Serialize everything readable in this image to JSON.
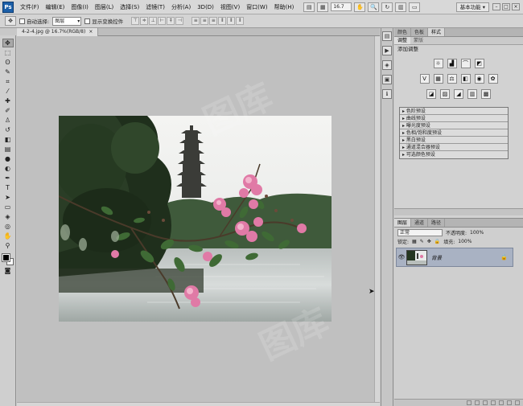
{
  "app": {
    "logo": "Ps"
  },
  "menu": [
    "文件(F)",
    "编辑(E)",
    "图像(I)",
    "图层(L)",
    "选择(S)",
    "滤镜(T)",
    "分析(A)",
    "3D(D)",
    "视图(V)",
    "窗口(W)",
    "帮助(H)"
  ],
  "menu_tools": {
    "zoom": "16.7",
    "workspace": "基本功能 ▾"
  },
  "options": {
    "auto_select_label": "自动选择:",
    "auto_select_value": "图层",
    "show_transform_label": "显示变换控件"
  },
  "document": {
    "tab_title": "4-2-4.jpg @ 16.7%(RGB/8)",
    "tab_close": "×"
  },
  "panel_top": {
    "tabs": [
      "颜色",
      "色板",
      "样式"
    ],
    "sub_tabs": [
      "调整",
      "蒙版"
    ],
    "title": "添加调整",
    "presets": [
      "色阶预设",
      "曲线预设",
      "曝光度预设",
      "色相/饱和度预设",
      "黑白预设",
      "通道混合器预设",
      "可选颜色预设"
    ]
  },
  "layers_panel": {
    "tabs": [
      "图层",
      "通道",
      "路径"
    ],
    "blend_mode": "正常",
    "opacity_label": "不透明度:",
    "opacity_value": "100%",
    "lock_label": "锁定:",
    "fill_label": "填充:",
    "fill_value": "100%",
    "layer_name": "背景"
  },
  "colors": {
    "foreground": "#000000",
    "background": "#ffffff",
    "layer_selected": "#a9b2c3"
  }
}
